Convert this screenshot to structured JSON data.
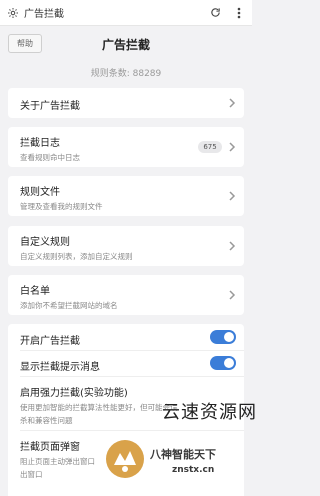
{
  "topbar": {
    "title": "广告拦截"
  },
  "header": {
    "help_label": "帮助",
    "title": "广告拦截"
  },
  "rule_count": "规则条数: 88289",
  "menu": [
    {
      "title": "关于广告拦截"
    },
    {
      "title": "拦截日志",
      "subtitle": "查看规则命中日志",
      "badge": "675"
    },
    {
      "title": "规则文件",
      "subtitle": "管理及查看我的规则文件"
    },
    {
      "title": "自定义规则",
      "subtitle": "自定义规则列表，添加自定义规则"
    },
    {
      "title": "白名单",
      "subtitle": "添加你不希望拦截网站的域名"
    }
  ],
  "settings": [
    {
      "title": "开启广告拦截",
      "enabled": true
    },
    {
      "title": "显示拦截提示消息",
      "enabled": true
    },
    {
      "title": "启用强力拦截(实验功能)",
      "subtitle_1": "使用更加智能的拦截算法性能更好，但可能会误",
      "subtitle_2": "杀和兼容性问题"
    },
    {
      "title": "拦截页面弹窗",
      "subtitle_1": "阻止页面主动弹出窗口",
      "subtitle_2": "出窗口"
    }
  ],
  "watermark": {
    "text": "云速资源网",
    "line1": "八神智能天下",
    "line2": "znstx.cn"
  }
}
